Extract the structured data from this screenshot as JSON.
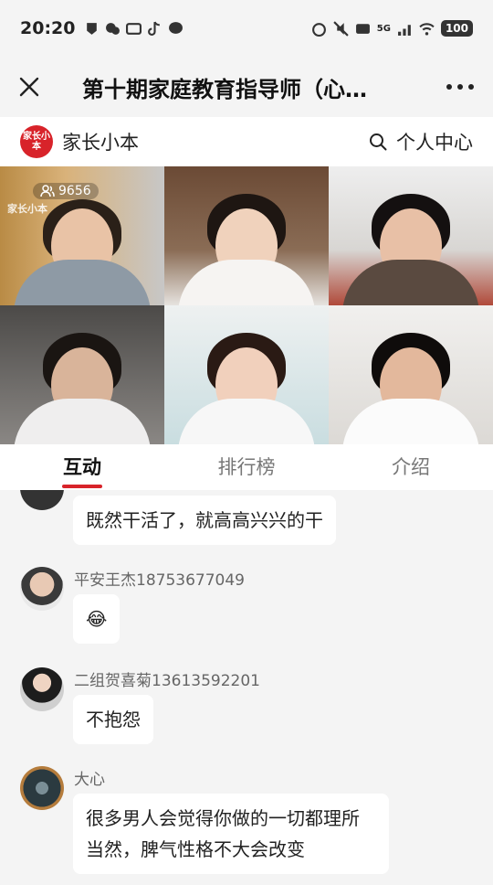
{
  "status_bar": {
    "time": "20:20",
    "network": "5G",
    "battery": "100"
  },
  "nav": {
    "title": "第十期家庭教育指导师（心…"
  },
  "brand": {
    "logo_text": "家长小本",
    "name": "家长小本",
    "personal_center": "个人中心"
  },
  "video": {
    "viewer_count": "9656",
    "watermark": "家长小本"
  },
  "tabs": [
    {
      "label": "互动"
    },
    {
      "label": "排行榜"
    },
    {
      "label": "介绍"
    }
  ],
  "messages": [
    {
      "sender": "",
      "text": "既然干活了，就高高兴兴的干"
    },
    {
      "sender": "平安王杰18753677049",
      "text": "😂"
    },
    {
      "sender": "二组贺喜菊13613592201",
      "text": "不抱怨"
    },
    {
      "sender": "大心",
      "text": "很多男人会觉得你做的一切都理所当然，脾气性格不大会改变"
    }
  ],
  "colors": {
    "accent": "#d8232a",
    "background": "#f4f4f4"
  }
}
